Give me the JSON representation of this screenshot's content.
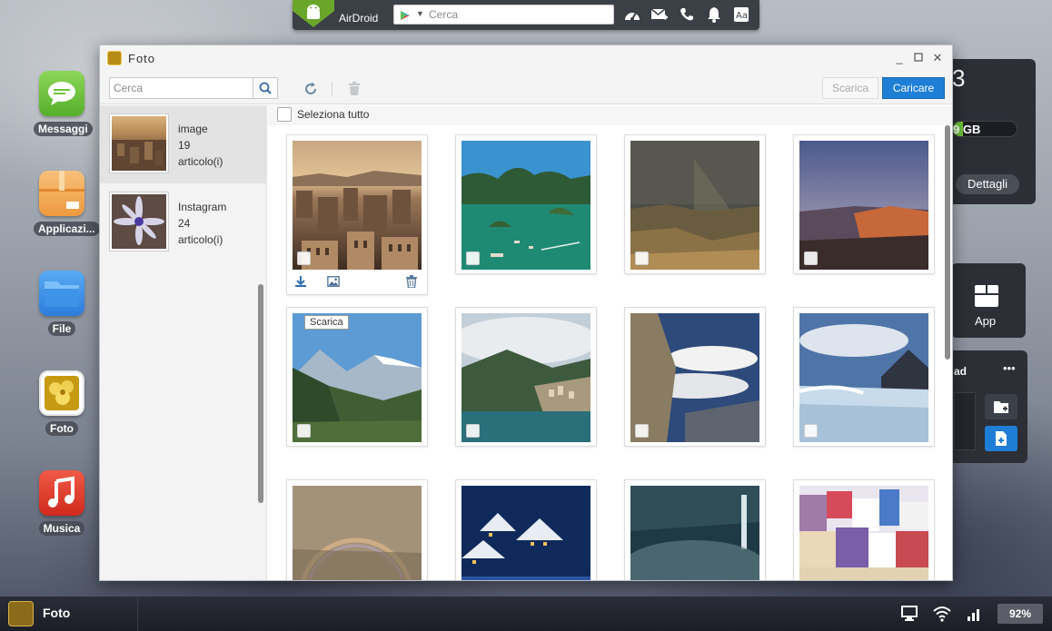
{
  "topbar": {
    "brand": "AirDroid",
    "search_placeholder": "Cerca",
    "icons": [
      "dashboard-icon",
      "mail-add-icon",
      "phone-icon",
      "bell-icon",
      "font-icon"
    ]
  },
  "dock": [
    {
      "label": "Messaggi",
      "icon": "messages-icon",
      "color": "#6cc33a"
    },
    {
      "label": "Applicazi...",
      "icon": "apps-box-icon",
      "color": "#f2a34a"
    },
    {
      "label": "File",
      "icon": "folder-icon",
      "color": "#2d8ae6"
    },
    {
      "label": "Foto",
      "icon": "photo-icon",
      "color": "#d9a71b"
    },
    {
      "label": "Musica",
      "icon": "music-icon",
      "color": "#e0392b"
    }
  ],
  "widgets": {
    "storage_number": "3",
    "storage_gb": "9 GB",
    "storage_fill_fraction": 0.15,
    "details_label": "Dettagli",
    "app_label": "App",
    "upload_title": "ad",
    "upload_more": "•••"
  },
  "window": {
    "title": "Foto",
    "search_placeholder": "Cerca",
    "download_label": "Scarica",
    "upload_label": "Caricare",
    "select_all_label": "Seleziona tutto",
    "tooltip": "Scarica"
  },
  "albums": [
    {
      "name": "image",
      "count": "19",
      "unit": "articolo(i)",
      "selected": true
    },
    {
      "name": "Instagram",
      "count": "24",
      "unit": "articolo(i)",
      "selected": false
    }
  ],
  "photos": [
    {
      "scene": "old-city-sunset"
    },
    {
      "scene": "bay-islands"
    },
    {
      "scene": "canyon-stormy"
    },
    {
      "scene": "canyon-dusk"
    },
    {
      "scene": "alpine-valley"
    },
    {
      "scene": "coastal-village"
    },
    {
      "scene": "cliff-clouds"
    },
    {
      "scene": "glacier"
    },
    {
      "scene": "rainbow-fog"
    },
    {
      "scene": "snow-village-night"
    },
    {
      "scene": "waterfall-mist"
    },
    {
      "scene": "colorful-houses"
    }
  ],
  "taskbar": {
    "app_name": "Foto",
    "battery": "92%",
    "icons": [
      "monitor-icon",
      "wifi-icon",
      "signal-icon"
    ]
  },
  "colors": {
    "accent": "#1f7fd6",
    "topbar": "#3b3f46",
    "logo_green": "#6aa62a"
  }
}
